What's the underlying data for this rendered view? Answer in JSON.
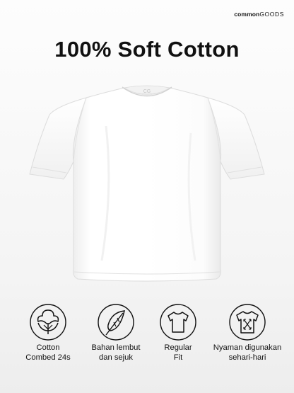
{
  "brand": {
    "part1": "common",
    "part2": "GOODS"
  },
  "headline": "100% Soft Cotton",
  "product": {
    "name": "t-shirt",
    "color": "#ffffff",
    "collar_logo": "CG"
  },
  "features": [
    {
      "icon": "cotton-flower-icon",
      "line1": "Cotton",
      "line2": "Combed 24s"
    },
    {
      "icon": "feather-icon",
      "line1": "Bahan lembut",
      "line2": "dan sejuk"
    },
    {
      "icon": "tshirt-outline-icon",
      "line1": "Regular",
      "line2": "Fit"
    },
    {
      "icon": "stretch-tshirt-icon",
      "line1": "Nyaman digunakan",
      "line2": "sehari-hari"
    }
  ],
  "colors": {
    "text": "#111111",
    "background": "#f4f4f4",
    "icon_stroke": "#111111"
  }
}
